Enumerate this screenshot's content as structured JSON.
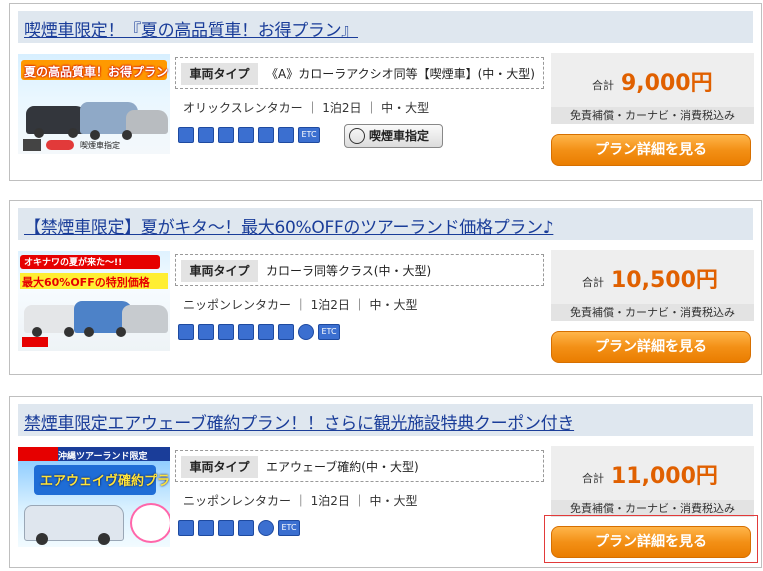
{
  "plans": [
    {
      "title": "喫煙車限定！『夏の高品質車！お得プラン』",
      "banner_text": "夏の高品質車！お得プラン",
      "banner_sub": "喫煙車指定",
      "vehicle_type_label": "車両タイプ",
      "vehicle_name": "《A》カローラアクシオ同等【喫煙車】(中・大型)",
      "provider": "オリックスレンタカー ｜ 1泊2日 ｜ 中・大型",
      "icons": [
        "navi-icon",
        "etc-icon-b",
        "child-seat-icon",
        "no-smoking-icon",
        "insurance-icon",
        "rental-icon",
        "etc-icon"
      ],
      "icon_text": [
        "",
        "",
        "",
        "",
        "",
        "",
        "ETC"
      ],
      "smoking_badge": "喫煙車指定",
      "total_label": "合計",
      "price": "9,000円",
      "price_note": "免責補償・カーナビ・消費税込み",
      "button_label": "プラン詳細を見る",
      "colors": {
        "banner": "#ff9900",
        "bg": "#d8ecff"
      }
    },
    {
      "title": "【禁煙車限定】夏がキタ～！最大60%OFFのツアーランド価格プラン♪",
      "banner_text": "オキナワの夏が来た～!!",
      "banner_sub": "最大60%OFFの特別価格",
      "vehicle_type_label": "車両タイプ",
      "vehicle_name": "カローラ同等クラス(中・大型)",
      "provider": "ニッポンレンタカー ｜ 1泊2日 ｜ 中・大型",
      "icons": [
        "navi-icon",
        "etc-icon-b",
        "child-seat-icon",
        "no-smoking-icon",
        "insurance-icon",
        "rental-icon",
        "no-smoking-icon",
        "etc-icon"
      ],
      "icon_text": [
        "",
        "",
        "",
        "",
        "",
        "",
        "",
        "ETC"
      ],
      "total_label": "合計",
      "price": "10,500円",
      "price_note": "免責補償・カーナビ・消費税込み",
      "button_label": "プラン詳細を見る",
      "colors": {
        "banner": "#e60000",
        "bg": "#fff7d0"
      }
    },
    {
      "title": "禁煙車限定エアウェーブ確約プラン！！さらに観光施設特典クーポン付き",
      "banner_text": "エアウェイヴ確約プラン",
      "banner_sub": "沖縄ツアーランド限定",
      "vehicle_type_label": "車両タイプ",
      "vehicle_name": "エアウェーブ確約(中・大型)",
      "provider": "ニッポンレンタカー ｜ 1泊2日 ｜ 中・大型",
      "icons": [
        "navi-icon",
        "etc-icon-b",
        "child-seat-icon",
        "rental-icon",
        "no-smoking-icon",
        "etc-icon"
      ],
      "icon_text": [
        "",
        "",
        "",
        "",
        "",
        "ETC"
      ],
      "total_label": "合計",
      "price": "11,000円",
      "price_note": "免責補償・カーナビ・消費税込み",
      "button_label": "プラン詳細を見る",
      "colors": {
        "banner": "#1f6dd6",
        "bg": "#e8f4ff"
      }
    }
  ]
}
